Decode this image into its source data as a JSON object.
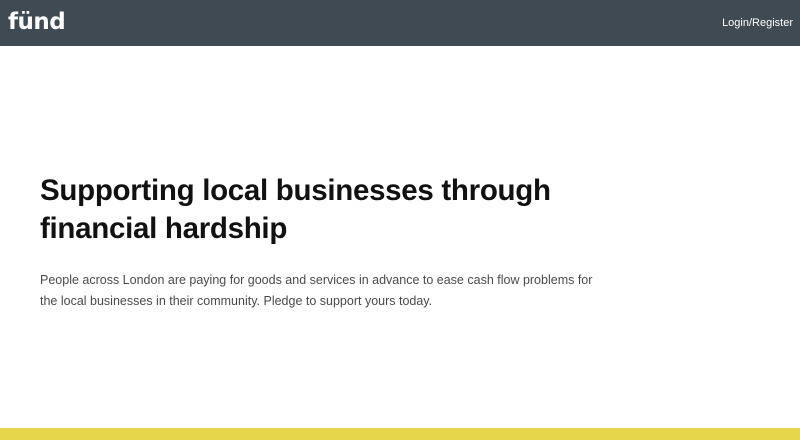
{
  "header": {
    "logo": "fünd",
    "login_label": "Login/Register"
  },
  "hero": {
    "title": "Supporting local businesses through financial hardship",
    "description": "People across London are paying for goods and services in advance to ease cash flow problems for the local businesses in their community. Pledge to support yours today."
  },
  "colors": {
    "navbar": "#3f4a52",
    "accent": "#e5d64a",
    "background": "#ffffff"
  }
}
